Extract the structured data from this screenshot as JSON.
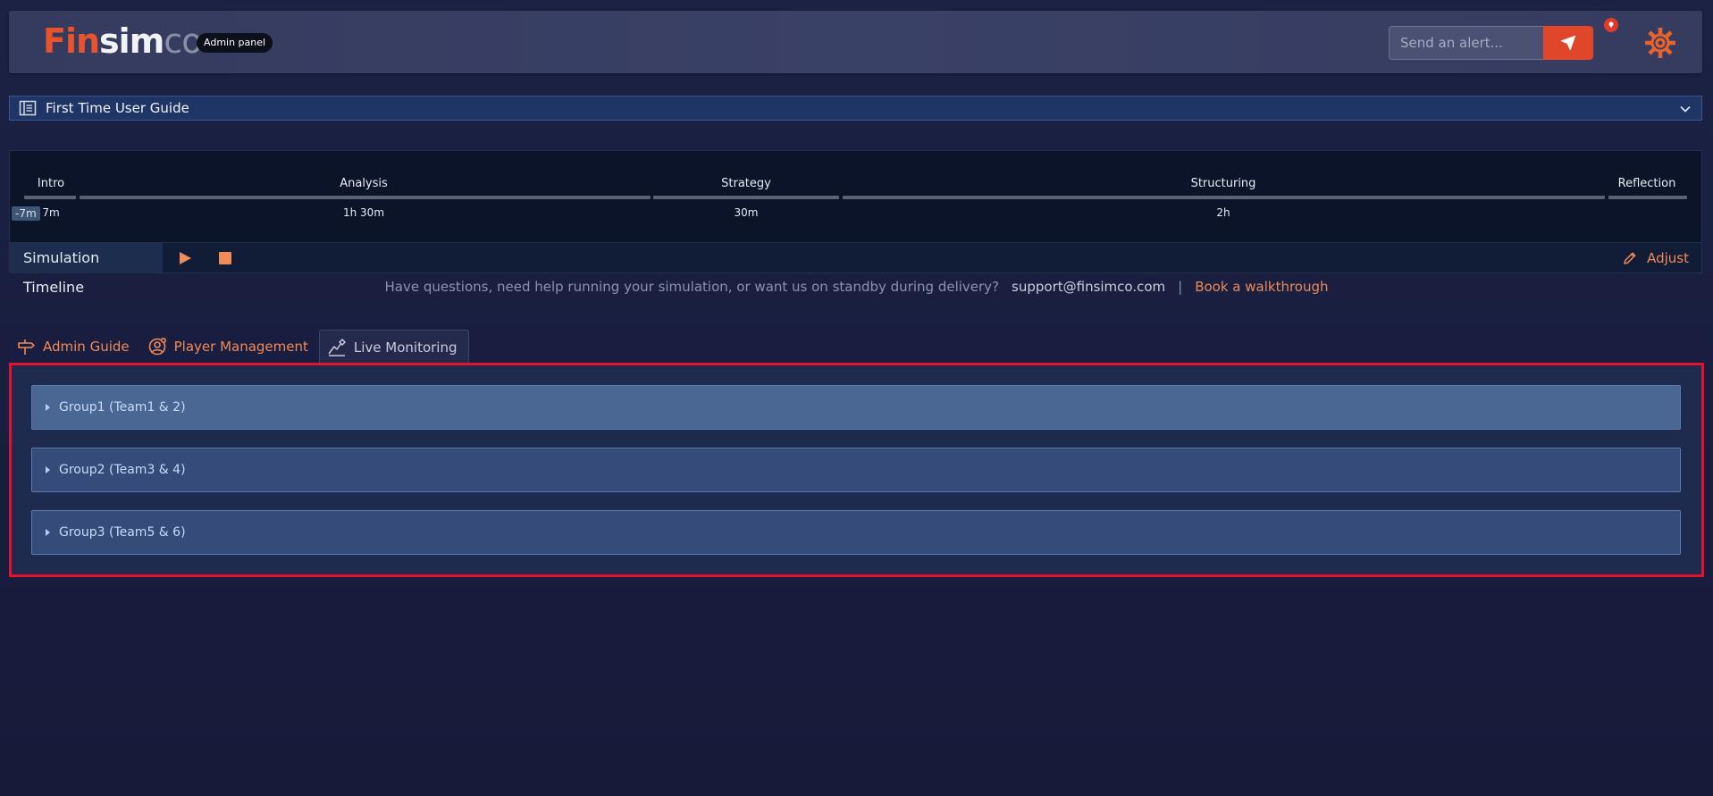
{
  "header": {
    "logo": {
      "part1": "Fin",
      "part2": "sim",
      "part3": "co"
    },
    "admin_badge": "Admin panel",
    "alert_placeholder": "Send an alert..."
  },
  "guide": {
    "title": "First Time User Guide"
  },
  "timeline": {
    "offset": "-7m",
    "phases": [
      {
        "name": "Intro",
        "duration": "7m"
      },
      {
        "name": "Analysis",
        "duration": "1h 30m"
      },
      {
        "name": "Strategy",
        "duration": "30m"
      },
      {
        "name": "Structuring",
        "duration": "2h"
      },
      {
        "name": "Reflection",
        "duration": ""
      }
    ],
    "controls_label": "Simulation Timeline",
    "adjust_label": "Adjust"
  },
  "help": {
    "question": "Have questions, need help running your simulation, or want us on standby during delivery?",
    "email": "support@finsimco.com",
    "separator": "|",
    "walkthrough": "Book a walkthrough"
  },
  "tabs": [
    {
      "label": "Admin Guide",
      "icon": "signpost-icon"
    },
    {
      "label": "Player Management",
      "icon": "user-settings-icon"
    },
    {
      "label": "Live Monitoring",
      "icon": "monitoring-icon",
      "active": true
    }
  ],
  "groups": [
    {
      "label": "Group1 (Team1 & 2)"
    },
    {
      "label": "Group2 (Team3 & 4)"
    },
    {
      "label": "Group3 (Team5 & 6)"
    }
  ],
  "colors": {
    "accent": "#e0472a",
    "highlight_border": "#e8112d",
    "tab_orange": "#ef8a58"
  }
}
